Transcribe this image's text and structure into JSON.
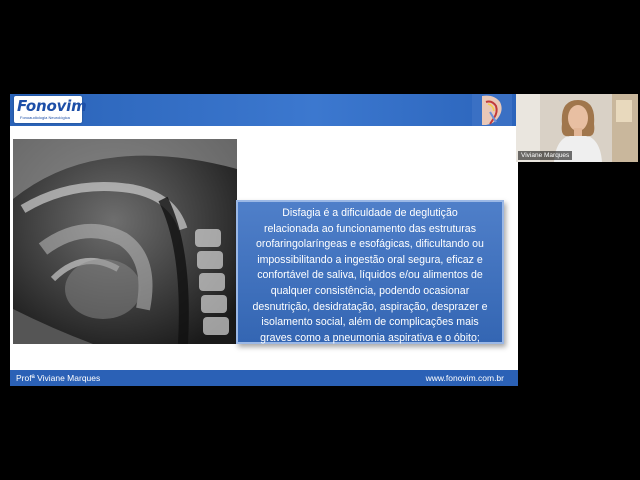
{
  "slide": {
    "logo_text": "Fonovim",
    "logo_subtitle": "Fonoaudiologia Neurológica",
    "body_lines": [
      "Disfagia é a dificuldade de deglutição",
      "relacionada ao funcionamento das estruturas",
      "orofaringolaríngeas e esofágicas, dificultando ou",
      "impossibilitando a ingestão oral segura, eficaz e",
      "confortável de saliva, líquidos e/ou alimentos de",
      "qualquer consistência, podendo ocasionar",
      "desnutrição, desidratação, aspiração, desprazer e",
      "isolamento social, além de complicações mais",
      "graves como a pneumonia aspirativa e o óbito;"
    ],
    "footer_left": "Profª Viviane Marques",
    "footer_right": "www.fonovim.com.br",
    "bar_color": "#2b61b6"
  },
  "participant": {
    "name": "Viviane Marques"
  }
}
